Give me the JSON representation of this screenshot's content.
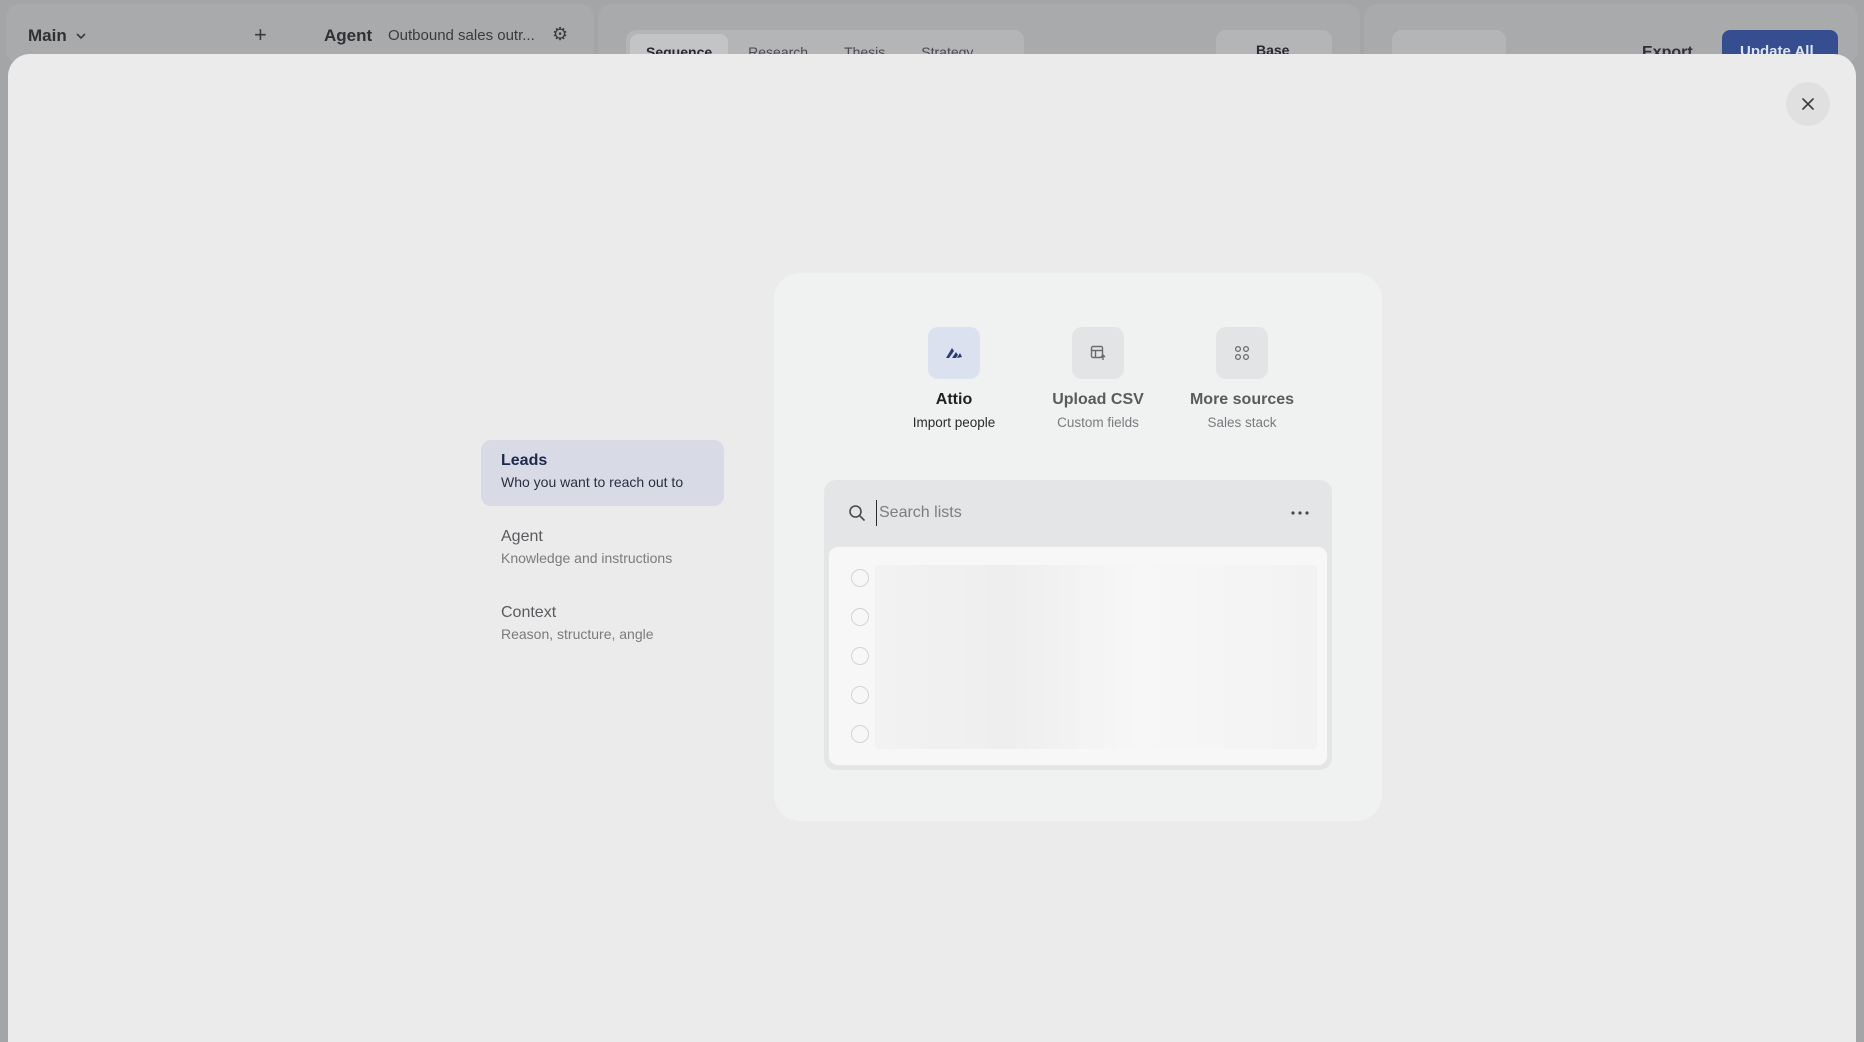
{
  "background": {
    "workspace": "Main",
    "agent_label": "Agent",
    "agent_name": "Outbound sales outr...",
    "tabs": [
      {
        "label": "Sequence",
        "active": true
      },
      {
        "label": "Research",
        "active": false
      },
      {
        "label": "Thesis",
        "active": false
      },
      {
        "label": "Strategy",
        "active": false
      }
    ],
    "model": "Base",
    "export": "Export",
    "update_all": "Update All"
  },
  "steps": [
    {
      "title": "Leads",
      "subtitle": "Who you want to reach out to",
      "active": true
    },
    {
      "title": "Agent",
      "subtitle": "Knowledge and instructions",
      "active": false
    },
    {
      "title": "Context",
      "subtitle": "Reason, structure, angle",
      "active": false
    }
  ],
  "sources": [
    {
      "title": "Attio",
      "subtitle": "Import people",
      "icon": "attio-logo-icon",
      "active": true
    },
    {
      "title": "Upload CSV",
      "subtitle": "Custom fields",
      "icon": "csv-upload-icon",
      "active": false
    },
    {
      "title": "More sources",
      "subtitle": "Sales stack",
      "icon": "grid-icon",
      "active": false
    }
  ],
  "search": {
    "placeholder": "Search lists",
    "value": ""
  },
  "list": {
    "row_count": 5
  },
  "colors": {
    "accent": "#354e90",
    "active_step_bg": "#d8dbe6",
    "overlay_bg": "#ebebeb",
    "card_bg": "#f0f1f1"
  }
}
